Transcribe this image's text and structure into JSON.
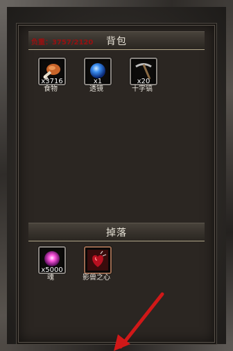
{
  "backpack": {
    "title": "背包",
    "capacity_label": "负重：3757/2120",
    "items": [
      {
        "name": "食物",
        "quantity": "x3716",
        "icon": "drumstick-icon"
      },
      {
        "name": "透镜",
        "quantity": "x1",
        "icon": "blue-orb-icon"
      },
      {
        "name": "十字镐",
        "quantity": "x20",
        "icon": "pickaxe-icon"
      }
    ]
  },
  "drops": {
    "title": "掉落",
    "items": [
      {
        "name": "魂",
        "quantity": "x5000",
        "icon": "soul-orb-icon"
      },
      {
        "name": "影兽之心",
        "quantity": "",
        "icon": "beast-heart-icon"
      }
    ]
  },
  "colors": {
    "capacity_text": "#9a1010",
    "title_text": "#e7e2d6",
    "arrow": "#d01818"
  }
}
